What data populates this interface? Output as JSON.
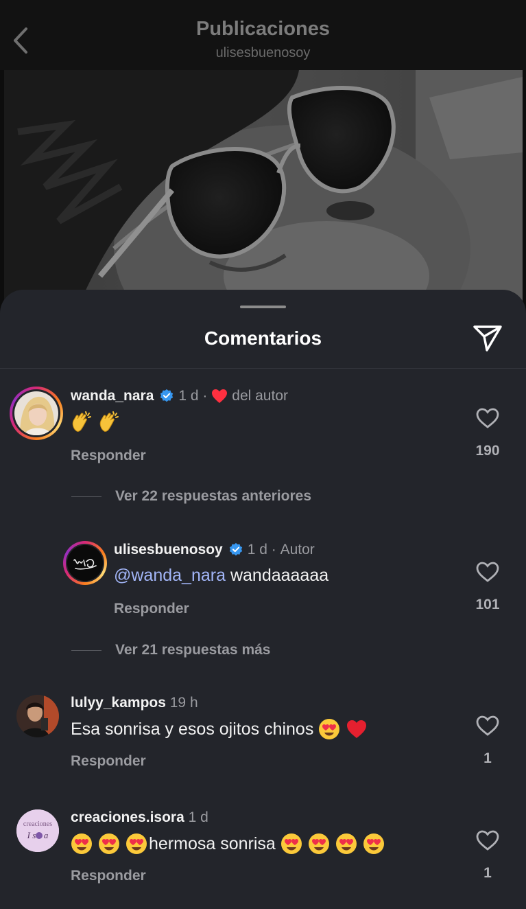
{
  "header": {
    "title": "Publicaciones",
    "subtitle": "ulisesbuenosoy"
  },
  "sheet": {
    "title": "Comentarios"
  },
  "comments": [
    {
      "username": "wanda_nara",
      "verified": true,
      "time": "1 d",
      "liked_by_author_label": "del autor",
      "text_emojis": [
        "clapping-hands",
        "clapping-hands"
      ],
      "reply_label": "Responder",
      "likes": "190",
      "view_replies": "Ver 22 respuestas anteriores"
    },
    {
      "username": "ulisesbuenosoy",
      "verified": true,
      "time": "1 d",
      "badge": "Autor",
      "mention": "@wanda_nara",
      "text": "wandaaaaaa",
      "reply_label": "Responder",
      "likes": "101",
      "view_replies": "Ver 21 respuestas más"
    },
    {
      "username": "lulyy_kampos",
      "time": "19 h",
      "text": "Esa sonrisa y esos ojitos chinos",
      "text_emojis": [
        "heart-eyes",
        "red-heart"
      ],
      "reply_label": "Responder",
      "likes": "1"
    },
    {
      "username": "creaciones.isora",
      "time": "1 d",
      "text": "hermosa sonrisa",
      "emojis_before": [
        "heart-eyes",
        "heart-eyes",
        "heart-eyes"
      ],
      "emojis_after": [
        "heart-eyes",
        "heart-eyes",
        "heart-eyes",
        "heart-eyes"
      ],
      "reply_label": "Responder",
      "likes": "1",
      "avatar_text": "creaciones I s o r a"
    }
  ],
  "colors": {
    "sheet_bg": "#23252b",
    "verified": "#3797f0",
    "mention": "#a2b5f7",
    "heart": "#ff3040"
  }
}
